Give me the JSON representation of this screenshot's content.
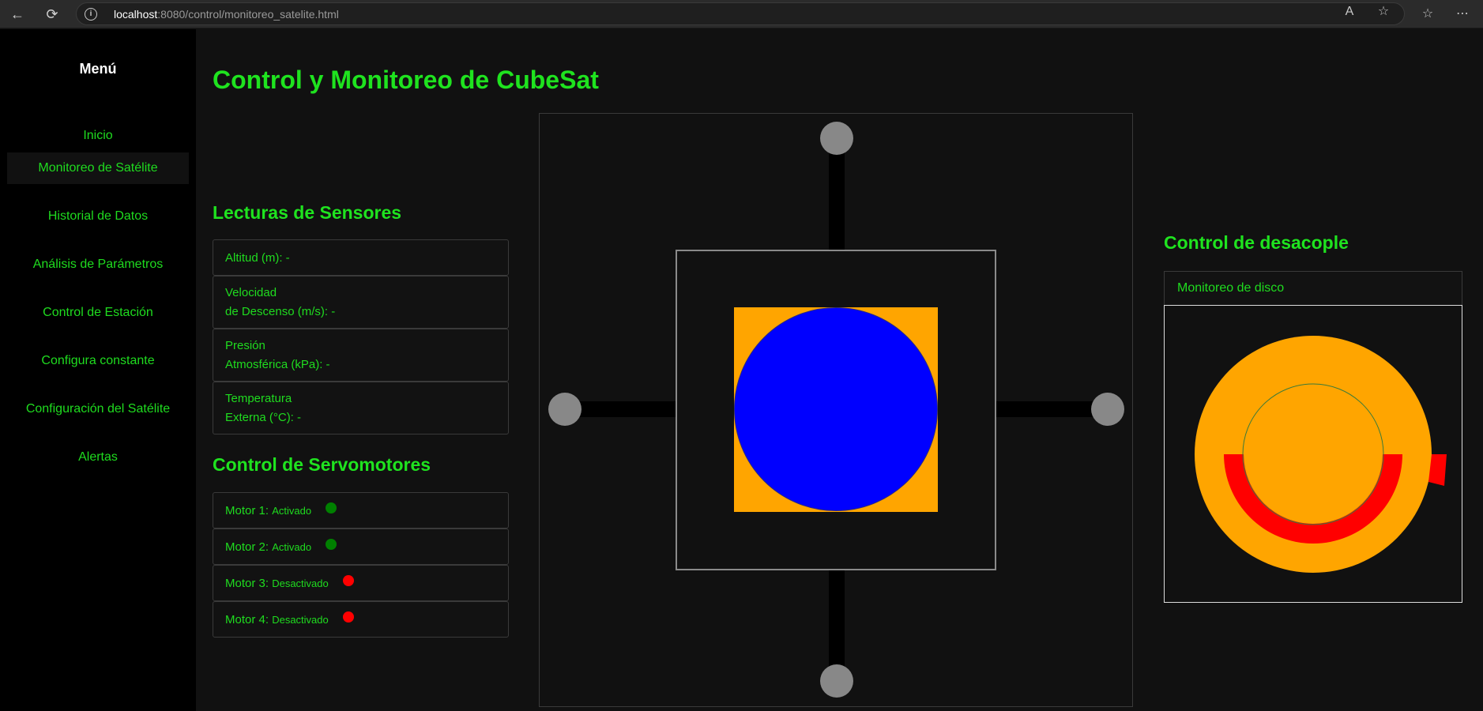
{
  "browser": {
    "url_host": "localhost",
    "url_path": ":8080/control/monitoreo_satelite.html",
    "icons": [
      "back-icon",
      "reload-icon",
      "info-icon",
      "read-aloud-icon",
      "star-icon",
      "favorites-icon",
      "more-icon"
    ]
  },
  "sidebar": {
    "title": "Menú",
    "items": [
      {
        "label": "Inicio",
        "active": false
      },
      {
        "label": "Monitoreo de Satélite",
        "active": true
      },
      {
        "label": "Historial de Datos",
        "active": false
      },
      {
        "label": "Análisis de Parámetros",
        "active": false
      },
      {
        "label": "Control de Estación",
        "active": false
      },
      {
        "label": "Configura constante",
        "active": false
      },
      {
        "label": "Configuración del Satélite",
        "active": false
      },
      {
        "label": "Alertas",
        "active": false
      }
    ]
  },
  "main": {
    "title": "Control y Monitoreo de CubeSat",
    "sensors": {
      "title": "Lecturas de Sensores",
      "readings": [
        {
          "line1": "Altitud (m): -",
          "line2": ""
        },
        {
          "line1": "Velocidad",
          "line2": "de Descenso (m/s): -"
        },
        {
          "line1": "Presión",
          "line2": "Atmosférica (kPa): -"
        },
        {
          "line1": "Temperatura",
          "line2": "Externa (°C): -"
        }
      ]
    },
    "servos": {
      "title": "Control de Servomotores",
      "motors": [
        {
          "label": "Motor 1:",
          "state": "Activado",
          "color": "#008000"
        },
        {
          "label": "Motor 2:",
          "state": "Activado",
          "color": "#008000"
        },
        {
          "label": "Motor 3:",
          "state": "Desactivado",
          "color": "#ff0000"
        },
        {
          "label": "Motor 4:",
          "state": "Desactivado",
          "color": "#ff0000"
        }
      ]
    },
    "decoupling": {
      "title": "Control de desacople",
      "tab_label": "Monitoreo de disco"
    }
  },
  "colors": {
    "accent": "#1fdc1f",
    "satellite_core": "#0000ff",
    "satellite_square": "#ffa500",
    "disk": "#ffa500",
    "disk_arc": "#ff0000",
    "node": "#888888"
  }
}
